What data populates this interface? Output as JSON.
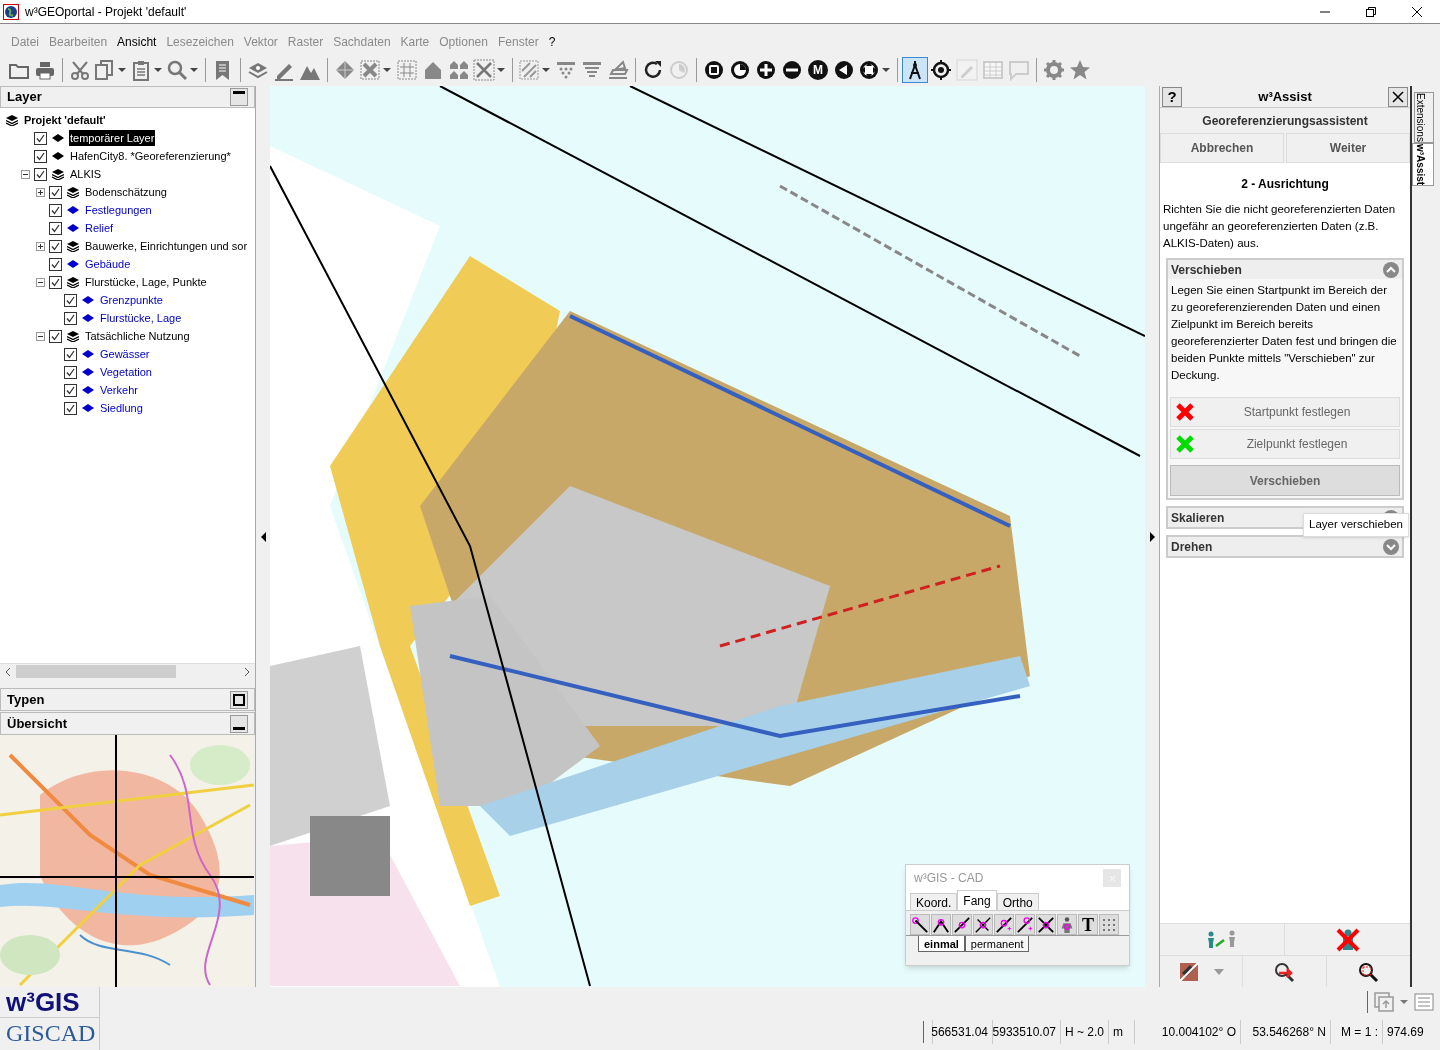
{
  "window": {
    "title": "w³GEOportal - Projekt 'default'"
  },
  "menu": [
    {
      "label": "Datei",
      "disabled": true
    },
    {
      "label": "Bearbeiten",
      "disabled": true
    },
    {
      "label": "Ansicht",
      "disabled": false
    },
    {
      "label": "Lesezeichen",
      "disabled": true
    },
    {
      "label": "Vektor",
      "disabled": true
    },
    {
      "label": "Raster",
      "disabled": true
    },
    {
      "label": "Sachdaten",
      "disabled": true
    },
    {
      "label": "Karte",
      "disabled": true
    },
    {
      "label": "Optionen",
      "disabled": true
    },
    {
      "label": "Fenster",
      "disabled": true
    },
    {
      "label": "?",
      "disabled": false
    }
  ],
  "toolbar": {
    "groups": [
      [
        {
          "selected": false,
          "disabled": false,
          "dropdown": false
        },
        {
          "selected": false,
          "disabled": false,
          "dropdown": false
        }
      ],
      [
        {
          "selected": false,
          "disabled": false,
          "dropdown": false
        },
        {
          "selected": false,
          "disabled": false,
          "dropdown": true
        },
        {
          "selected": false,
          "disabled": false,
          "dropdown": true
        },
        {
          "selected": false,
          "disabled": false,
          "dropdown": true
        }
      ],
      [
        {
          "selected": false,
          "disabled": false,
          "dropdown": false
        }
      ],
      [
        {
          "selected": false,
          "disabled": false,
          "dropdown": false
        },
        {
          "selected": false,
          "disabled": false,
          "dropdown": false
        },
        {
          "selected": false,
          "disabled": false,
          "dropdown": false
        }
      ],
      [
        {
          "selected": false,
          "disabled": false,
          "dropdown": false
        },
        {
          "selected": false,
          "disabled": false,
          "dropdown": true
        },
        {
          "selected": false,
          "disabled": false,
          "dropdown": false
        },
        {
          "selected": false,
          "disabled": false,
          "dropdown": false
        },
        {
          "selected": false,
          "disabled": false,
          "dropdown": false
        },
        {
          "selected": false,
          "disabled": false,
          "dropdown": true
        }
      ],
      [
        {
          "selected": false,
          "disabled": false,
          "dropdown": true
        },
        {
          "selected": false,
          "disabled": false,
          "dropdown": false
        },
        {
          "selected": false,
          "disabled": false,
          "dropdown": false
        },
        {
          "selected": false,
          "disabled": false,
          "dropdown": false
        }
      ],
      [
        {
          "selected": false,
          "disabled": false,
          "dropdown": false
        },
        {
          "selected": false,
          "disabled": true,
          "dropdown": false
        }
      ],
      [
        {
          "selected": false,
          "disabled": false,
          "dropdown": false
        },
        {
          "selected": false,
          "disabled": false,
          "dropdown": false
        },
        {
          "selected": false,
          "disabled": false,
          "dropdown": false
        },
        {
          "selected": false,
          "disabled": false,
          "dropdown": false
        },
        {
          "selected": false,
          "disabled": false,
          "dropdown": false,
          "label": "M"
        },
        {
          "selected": false,
          "disabled": false,
          "dropdown": false
        },
        {
          "selected": false,
          "disabled": false,
          "dropdown": true
        }
      ],
      [
        {
          "selected": true,
          "disabled": false,
          "dropdown": false
        },
        {
          "selected": false,
          "disabled": false,
          "dropdown": false
        },
        {
          "selected": false,
          "disabled": true,
          "dropdown": false
        },
        {
          "selected": false,
          "disabled": true,
          "dropdown": false
        },
        {
          "selected": false,
          "disabled": true,
          "dropdown": false
        }
      ],
      [
        {
          "selected": false,
          "disabled": false,
          "dropdown": false
        },
        {
          "selected": false,
          "disabled": false,
          "dropdown": false
        }
      ]
    ]
  },
  "layer_panel": {
    "title": "Layer",
    "tree": {
      "label": "Projekt 'default'",
      "kind": "group",
      "color": "#000000",
      "children": [
        {
          "label": "temporärer Layer",
          "kind": "layer",
          "color": "#000000",
          "checked": true,
          "selected": true
        },
        {
          "label": "HafenCity8. *Georeferenzierung*",
          "kind": "layer",
          "color": "#000000",
          "checked": true,
          "selected": false
        },
        {
          "label": "ALKIS",
          "kind": "group",
          "color": "#000000",
          "checked": true,
          "selected": false,
          "expanded": true,
          "children": [
            {
              "label": "Bodenschätzung",
              "kind": "group",
              "color": "#000000",
              "checked": true,
              "selected": false,
              "expanded": false
            },
            {
              "label": "Festlegungen",
              "kind": "layer",
              "color": "#0000cc",
              "checked": true,
              "selected": false
            },
            {
              "label": "Relief",
              "kind": "layer",
              "color": "#0000cc",
              "checked": true,
              "selected": false
            },
            {
              "label": "Bauwerke, Einrichtungen und sor",
              "kind": "group",
              "color": "#000000",
              "checked": true,
              "selected": false,
              "expanded": false
            },
            {
              "label": "Gebäude",
              "kind": "layer",
              "color": "#0000cc",
              "checked": true,
              "selected": false
            },
            {
              "label": "Flurstücke, Lage, Punkte",
              "kind": "group",
              "color": "#000000",
              "checked": true,
              "selected": false,
              "expanded": true,
              "children": [
                {
                  "label": "Grenzpunkte",
                  "kind": "layer",
                  "color": "#0000cc",
                  "checked": true,
                  "selected": false
                },
                {
                  "label": "Flurstücke, Lage",
                  "kind": "layer",
                  "color": "#0000cc",
                  "checked": true,
                  "selected": false
                }
              ]
            },
            {
              "label": "Tatsächliche Nutzung",
              "kind": "group",
              "color": "#000000",
              "checked": true,
              "selected": false,
              "expanded": true,
              "children": [
                {
                  "label": "Gewässer",
                  "kind": "layer",
                  "color": "#0000cc",
                  "checked": true,
                  "selected": false
                },
                {
                  "label": "Vegetation",
                  "kind": "layer",
                  "color": "#0000cc",
                  "checked": true,
                  "selected": false
                },
                {
                  "label": "Verkehr",
                  "kind": "layer",
                  "color": "#0000cc",
                  "checked": true,
                  "selected": false
                },
                {
                  "label": "Siedlung",
                  "kind": "layer",
                  "color": "#0000cc",
                  "checked": true,
                  "selected": false
                }
              ]
            }
          ]
        }
      ]
    }
  },
  "types_panel": {
    "title": "Typen",
    "expanded": false
  },
  "overview_panel": {
    "title": "Übersicht",
    "expanded": true
  },
  "logos": [
    "w³GIS",
    "GISCAD"
  ],
  "assist_panel": {
    "help": "?",
    "title": "w³Assist",
    "wizard_title": "Georeferenzierungsassistent",
    "buttons": [
      "Abbrechen",
      "Weiter"
    ],
    "step_title": "2 - Ausrichtung",
    "intro": "Richten Sie die nicht georeferenzierten Daten ungefähr an georeferenzierten Daten (z.B. ALKIS-Daten) aus.",
    "sections": [
      {
        "title": "Verschieben",
        "expanded": true,
        "text": "Legen Sie einen Startpunkt im Bereich der zu georeferenzierenden Daten und einen Zielpunkt im Bereich bereits georeferenzierter Daten fest und bringen die beiden Punkte mittels \"Verschieben\" zur Deckung.",
        "point_buttons": [
          {
            "label": "Startpunkt festlegen",
            "color": "#ff0000"
          },
          {
            "label": "Zielpunkt festlegen",
            "color": "#00dd00"
          }
        ],
        "action": "Verschieben"
      },
      {
        "title": "Skalieren",
        "expanded": false
      },
      {
        "title": "Drehen",
        "expanded": false
      }
    ],
    "tooltip": "Layer verschieben"
  },
  "side_tabs": [
    {
      "label": "Extensions",
      "selected": false
    },
    {
      "label": "w³Assist",
      "selected": true
    }
  ],
  "cad_window": {
    "title": "w³GIS - CAD",
    "tabs": [
      {
        "label": "Koord.",
        "selected": false
      },
      {
        "label": "Fang",
        "selected": true
      },
      {
        "label": "Ortho",
        "selected": false
      }
    ],
    "text_tool": "T",
    "modes": [
      {
        "label": "einmal",
        "selected": true
      },
      {
        "label": "permanent",
        "selected": false
      }
    ]
  },
  "status_bar": {
    "fields": [
      "566531.04",
      "5933510.07",
      "H ~ 2.0",
      "m",
      "10.004102° O",
      "53.546268° N",
      "M = 1 :",
      "974.69"
    ]
  }
}
